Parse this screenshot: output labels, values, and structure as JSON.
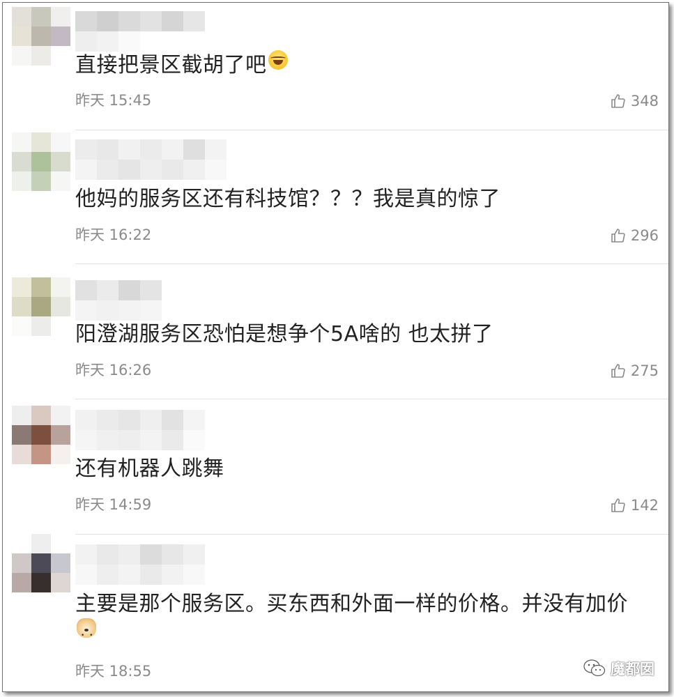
{
  "comments": [
    {
      "text": "直接把景区截胡了吧",
      "emoji": "laughing-tears-emoji",
      "time": "昨天 15:45",
      "likes": "348"
    },
    {
      "text": "他妈的服务区还有科技馆？？？我是真的惊了",
      "emoji": "",
      "time": "昨天 16:22",
      "likes": "296"
    },
    {
      "text": "阳澄湖服务区恐怕是想争个5A啥的 也太拼了",
      "emoji": "",
      "time": "昨天 16:26",
      "likes": "275"
    },
    {
      "text": "还有机器人跳舞",
      "emoji": "",
      "time": "昨天 14:59",
      "likes": "142"
    },
    {
      "text": "主要是那个服务区。买东西和外面一样的价格。并没有加价",
      "emoji": "doge-emoji",
      "time": "昨天 18:55",
      "likes": ""
    }
  ],
  "watermark": {
    "text": "魔都囡",
    "icon": "wechat-icon"
  },
  "icons": {
    "like": "thumbs-up-icon"
  },
  "colors": {
    "text": "#222222",
    "meta": "#8a8a8a",
    "divider": "#e2e2e2"
  }
}
